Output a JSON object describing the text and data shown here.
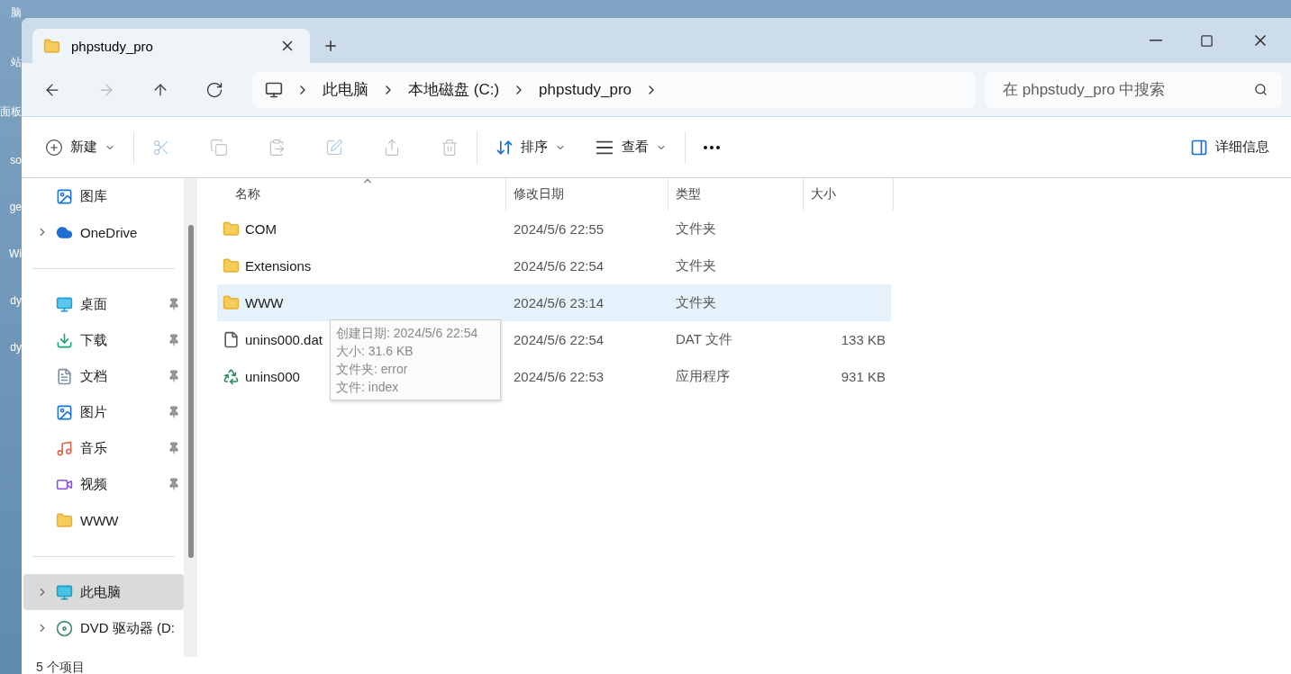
{
  "desktop_icons": [
    {
      "label": "脑"
    },
    {
      "label": "站"
    },
    {
      "label": "面板"
    },
    {
      "label": "so"
    },
    {
      "label": "ge"
    },
    {
      "label": "Wi"
    },
    {
      "label": "dy"
    },
    {
      "label": "dy"
    }
  ],
  "tabs": [
    {
      "title": "phpstudy_pro",
      "selected": true
    }
  ],
  "navigation": [
    {
      "disabled": false
    },
    {
      "disabled": true
    },
    {
      "disabled": false
    },
    {
      "disabled": false
    }
  ],
  "breadcrumb": [
    "此电脑",
    "本地磁盘 (C:)",
    "phpstudy_pro"
  ],
  "search": {
    "placeholder": "在 phpstudy_pro 中搜索"
  },
  "toolbar": {
    "new": "新建",
    "actions": [
      {
        "disabled": true
      },
      {
        "disabled": true
      },
      {
        "disabled": true
      },
      {
        "disabled": true
      },
      {
        "disabled": true
      },
      {
        "disabled": true
      }
    ],
    "sort": "排序",
    "view": "查看",
    "details": "详细信息"
  },
  "sidebar": {
    "sections": [
      {
        "items": [
          {
            "label": "图库",
            "expandable": false,
            "pinned": false,
            "selected": false
          },
          {
            "label": "OneDrive",
            "expandable": true,
            "pinned": false,
            "selected": false
          }
        ]
      },
      {
        "items": [
          {
            "label": "桌面",
            "expandable": false,
            "pinned": true,
            "selected": false
          },
          {
            "label": "下载",
            "expandable": false,
            "pinned": true,
            "selected": false
          },
          {
            "label": "文档",
            "expandable": false,
            "pinned": true,
            "selected": false
          },
          {
            "label": "图片",
            "expandable": false,
            "pinned": true,
            "selected": false
          },
          {
            "label": "音乐",
            "expandable": false,
            "pinned": true,
            "selected": false
          },
          {
            "label": "视频",
            "expandable": false,
            "pinned": true,
            "selected": false
          },
          {
            "label": "WWW",
            "expandable": false,
            "pinned": false,
            "selected": false
          }
        ]
      },
      {
        "items": [
          {
            "label": "此电脑",
            "expandable": true,
            "pinned": false,
            "selected": true
          },
          {
            "label": "DVD 驱动器 (D:",
            "expandable": true,
            "pinned": false,
            "selected": false
          }
        ]
      }
    ]
  },
  "table": {
    "columns": [
      "名称",
      "修改日期",
      "类型",
      "大小"
    ],
    "rows": [
      {
        "kind": "folder",
        "name": "COM",
        "modified": "2024/5/6 22:55",
        "type": "文件夹",
        "selected": false
      },
      {
        "kind": "folder",
        "name": "Extensions",
        "modified": "2024/5/6 22:54",
        "type": "文件夹",
        "selected": false
      },
      {
        "kind": "folder",
        "name": "WWW",
        "modified": "2024/5/6 23:14",
        "type": "文件夹",
        "selected": true
      },
      {
        "kind": "file",
        "name": "unins000.dat",
        "modified": "2024/5/6 22:54",
        "type": "DAT 文件",
        "size": "133 KB",
        "selected": false
      },
      {
        "kind": "app",
        "name": "unins000",
        "modified": "2024/5/6 22:53",
        "type": "应用程序",
        "size": "931 KB",
        "selected": false
      }
    ]
  },
  "tooltip": [
    "创建日期: 2024/5/6 22:54",
    "大小: 31.6 KB",
    "文件夹: error",
    "文件: index"
  ],
  "status_bar": "5 个项目"
}
